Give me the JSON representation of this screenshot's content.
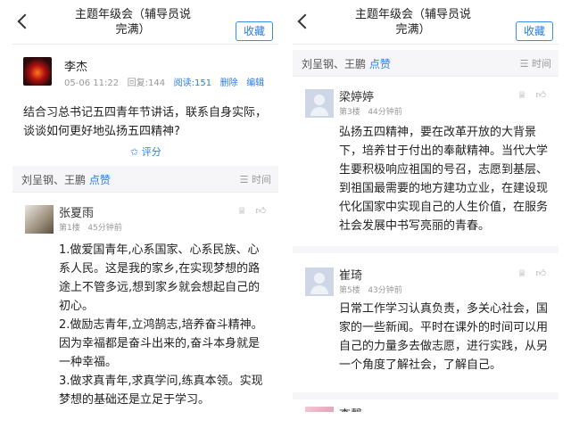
{
  "header": {
    "title_line1": "主题年级会（辅导员说",
    "title_line2": "完满）",
    "favorite_label": "收藏"
  },
  "post": {
    "author": "李杰",
    "date": "05-06 11:22",
    "replies": "回复:144",
    "reads": "阅读:151",
    "delete_label": "删除",
    "edit_label": "编辑",
    "text": "结合习总书记五四青年节讲话，联系自身实际，谈谈如何更好地弘扬五四精神?",
    "rate_label": "评分"
  },
  "likebar": {
    "names": "刘呈钢、王鹏",
    "like_label": "点赞",
    "sort_label": "时间"
  },
  "left_comments": [
    {
      "name": "张夏雨",
      "floor": "第1楼",
      "time": "45分钟前",
      "text": "1.做爱国青年,心系国家、心系民族、心系人民。这是我的家乡,在实现梦想的路途上不管多远,想到家乡就会想起自己的初心。\n2.做励志青年,立鸿鹄志,培养奋斗精神。因为幸福都是奋斗出来的,奋斗本身就是一种幸福。\n3.做求真青年,求真学问,练真本领。实现梦想的基础还是立足于学习。"
    }
  ],
  "right_comments": [
    {
      "name": "梁婷婷",
      "floor": "第3楼",
      "time": "44分钟前",
      "text": "弘扬五四精神，要在改革开放的大背景下，培养甘于付出的奉献精神。当代大学生要积极响应祖国的号召，志愿到基层、到祖国最需要的地方建功立业，在建设现代化国家中实现自己的人生价值，在服务社会发展中书写亮丽的青春。"
    },
    {
      "name": "崔琦",
      "floor": "第5楼",
      "time": "43分钟前",
      "text": "日常工作学习认真负责，多关心社会，国家的一些新闻。平时在课外的时间可以用自己的力量多去做志愿，进行实践，从另一个角度了解社会，了解自己。"
    },
    {
      "name": "李馨",
      "floor": "",
      "time": "",
      "text": ""
    }
  ],
  "icons": {
    "back": "chevron-left-icon",
    "rate": "rating-icon",
    "sort": "sort-icon",
    "thumb": "thumb-up-icon",
    "hat": "award-icon"
  },
  "colors": {
    "accent": "#2a7de1",
    "bar_bg": "#f6f6f8"
  }
}
